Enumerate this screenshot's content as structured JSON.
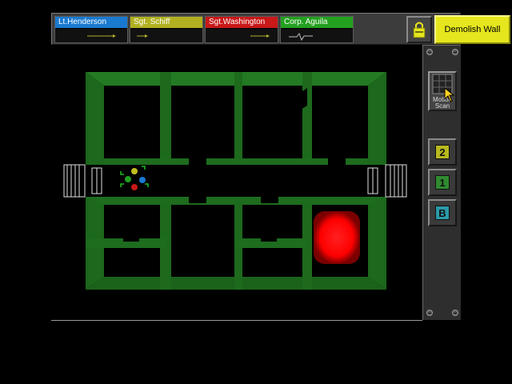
{
  "squad": [
    {
      "name": "Lt.Henderson",
      "color": "#1a7ad0",
      "icon": "arrow-icon"
    },
    {
      "name": "Sgt. Schiff",
      "color": "#b0b020",
      "icon": "arrow-icon"
    },
    {
      "name": "Sgt.Washington",
      "color": "#c81818",
      "icon": "arrow-icon"
    },
    {
      "name": "Corp. Aguila",
      "color": "#24a020",
      "icon": "heartbeat-icon"
    }
  ],
  "toolbar": {
    "lock_icon": "padlock-icon",
    "demolish_label": "Demolish Wall"
  },
  "side": {
    "motion_label_1": "Motion",
    "motion_label_2": "Scan",
    "floors": [
      {
        "label": "2",
        "color": "#b8b820"
      },
      {
        "label": "1",
        "color": "#2f8a2f"
      },
      {
        "label": "B",
        "color": "#2a9aaa"
      }
    ]
  },
  "colors": {
    "wall": "#1f6e1f",
    "floor": "#000000",
    "hazard": "#ff0000"
  }
}
